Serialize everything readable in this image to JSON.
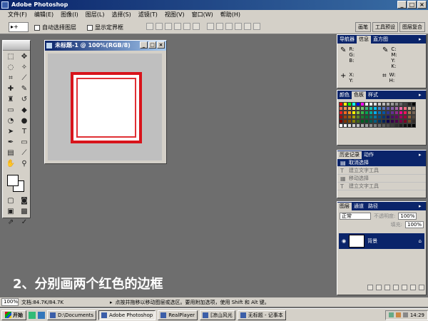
{
  "window": {
    "title": "Adobe Photoshop",
    "controls": [
      "_",
      "□",
      "×"
    ]
  },
  "menu": [
    "文件(F)",
    "编辑(E)",
    "图像(I)",
    "图层(L)",
    "选择(S)",
    "滤镜(T)",
    "视图(V)",
    "窗口(W)",
    "帮助(H)"
  ],
  "options": {
    "tool_label": "▸+",
    "auto_select": "自动选择图层",
    "show_bounds": "显示定界框",
    "tabs": [
      "画笔",
      "工具预设",
      "图层复合"
    ]
  },
  "document": {
    "title": "未标题-1 @ 100%(RGB/8)",
    "frame_color": "#d8141b",
    "frame_inner_color": "#e03035"
  },
  "palettes": {
    "navigator": {
      "tabs": [
        "导航器",
        "信息",
        "直方图"
      ],
      "active_tab_index": 1,
      "info": [
        {
          "glyph": "✎",
          "labels": [
            "R:",
            "G:",
            "B:"
          ]
        },
        {
          "glyph": "✎",
          "labels": [
            "C:",
            "M:",
            "Y:",
            "K:"
          ]
        },
        {
          "glyph": "+",
          "labels": [
            "X:",
            "Y:"
          ]
        },
        {
          "glyph": "⌗",
          "labels": [
            "W:",
            "H:"
          ]
        }
      ]
    },
    "swatches": {
      "tabs": [
        "颜色",
        "色板",
        "样式"
      ],
      "active_tab_index": 1,
      "colors": [
        "#ff0000",
        "#ffff00",
        "#00ff00",
        "#00ffff",
        "#0000ff",
        "#ff00ff",
        "#ffffff",
        "#eeeeee",
        "#dddddd",
        "#cccccc",
        "#bbbbbb",
        "#aaaaaa",
        "#999999",
        "#888888",
        "#666666",
        "#444444",
        "#222222",
        "#000000",
        "#f26c4f",
        "#f68e55",
        "#fbaf5d",
        "#fff467",
        "#acd372",
        "#7cc576",
        "#3bb878",
        "#1abbb4",
        "#00bff3",
        "#438cca",
        "#5574b9",
        "#605ca8",
        "#855fa8",
        "#a763a8",
        "#f06ea9",
        "#f26d7d",
        "#c7b299",
        "#998675",
        "#ed1c24",
        "#f26522",
        "#f7941d",
        "#fff200",
        "#8dc63f",
        "#39b54a",
        "#00a651",
        "#00a99d",
        "#00aeef",
        "#0072bc",
        "#0054a6",
        "#2e3192",
        "#662d91",
        "#92278f",
        "#ec008c",
        "#ed145b",
        "#a67c52",
        "#736357",
        "#9e0b0f",
        "#a0410d",
        "#a36209",
        "#aba000",
        "#598527",
        "#1a7b30",
        "#007236",
        "#00746b",
        "#0076a3",
        "#004a80",
        "#003471",
        "#1b1464",
        "#440e62",
        "#630460",
        "#9e005d",
        "#9e0039",
        "#8c6239",
        "#534741",
        "#790000",
        "#7b2e00",
        "#7d4900",
        "#827b00",
        "#406618",
        "#005e20",
        "#005826",
        "#005952",
        "#005b7f",
        "#003663",
        "#002157",
        "#0d004c",
        "#32004b",
        "#4b0049",
        "#7b0046",
        "#7a0026",
        "#754c24",
        "#362f2d",
        "#ffffff",
        "#f0f0f0",
        "#e0e0e0",
        "#d0d0d0",
        "#c0c0c0",
        "#b0b0b0",
        "#a0a0a0",
        "#909090",
        "#808080",
        "#707070",
        "#606060",
        "#505050",
        "#404040",
        "#303030",
        "#202020",
        "#101010",
        "#080808",
        "#000000"
      ]
    },
    "history": {
      "tabs": [
        "历史记录",
        "动作"
      ],
      "active_tab_index": 0,
      "items": [
        {
          "label": "取消选择",
          "active": true,
          "icon": "▤"
        },
        {
          "label": "建立文字工具",
          "active": false,
          "icon": "T"
        },
        {
          "label": "移动选择",
          "active": false,
          "icon": "▦"
        },
        {
          "label": "建立文字工具",
          "active": false,
          "icon": "T"
        }
      ]
    },
    "layers": {
      "tabs": [
        "图层",
        "通道",
        "路径"
      ],
      "active_tab_index": 0,
      "blend_mode": "正常",
      "opacity_label": "不透明度:",
      "opacity": "100%",
      "fill_label": "填充:",
      "fill": "100%",
      "layer_name": "背景"
    }
  },
  "caption": "2、分别画两个红色的边框",
  "status": {
    "zoom": "100%",
    "doc_info": "文档:84.7K/84.7K",
    "hint": "点按并拖移以移动图层或选区。要用附加选项，使用 Shift 和 Alt 键。"
  },
  "taskbar": {
    "start": "开始",
    "items": [
      {
        "label": "D:\\Documents",
        "active": false
      },
      {
        "label": "Adobe Photoshop",
        "active": true
      },
      {
        "label": "RealPlayer",
        "active": false
      },
      {
        "label": "[凉山风光",
        "active": false
      },
      {
        "label": "无标题 - 记事本",
        "active": false
      }
    ],
    "clock": "14:29"
  },
  "colors": {
    "workspace": "#6e6e6e",
    "active_title": "#0a246a",
    "chrome": "#d4d0c8"
  }
}
